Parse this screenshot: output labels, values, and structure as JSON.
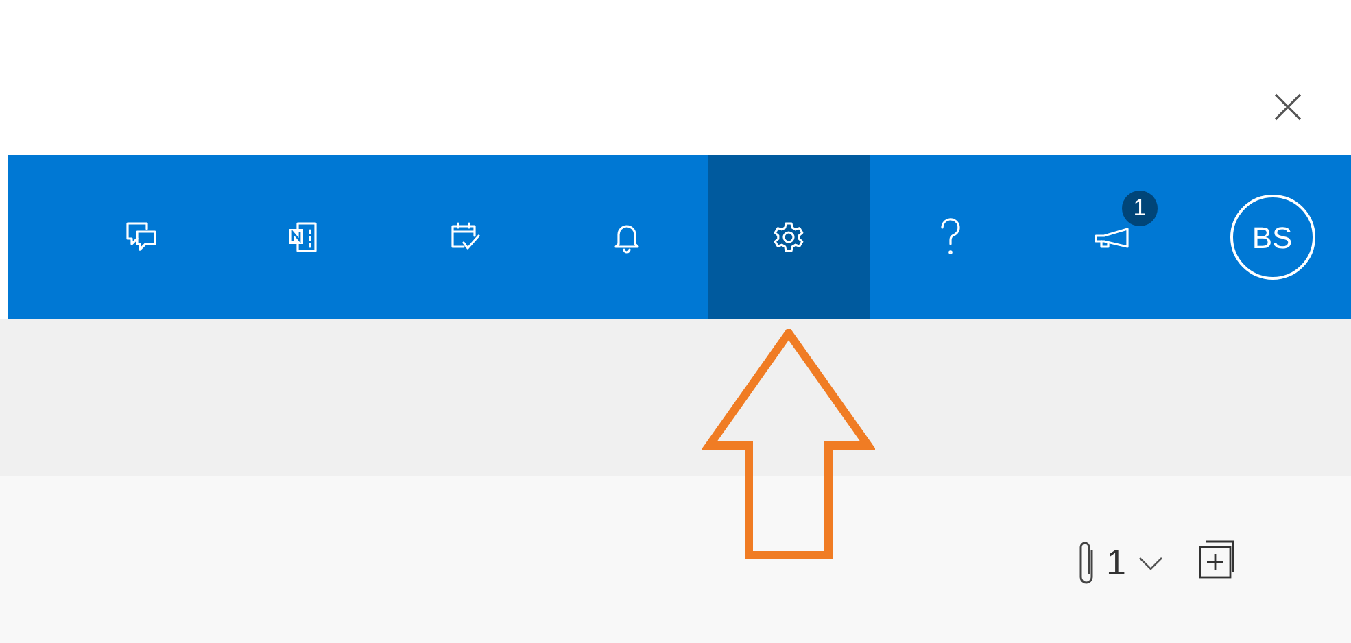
{
  "toolbar": {
    "items": [
      {
        "kind": "chat",
        "selected": false
      },
      {
        "kind": "notes",
        "selected": false
      },
      {
        "kind": "tasks",
        "selected": false
      },
      {
        "kind": "bell",
        "selected": false
      },
      {
        "kind": "gear",
        "selected": true
      },
      {
        "kind": "help",
        "selected": false
      },
      {
        "kind": "megaphone",
        "selected": false,
        "badge": "1"
      }
    ],
    "avatar": "BS"
  },
  "attachments": {
    "count": "1"
  }
}
